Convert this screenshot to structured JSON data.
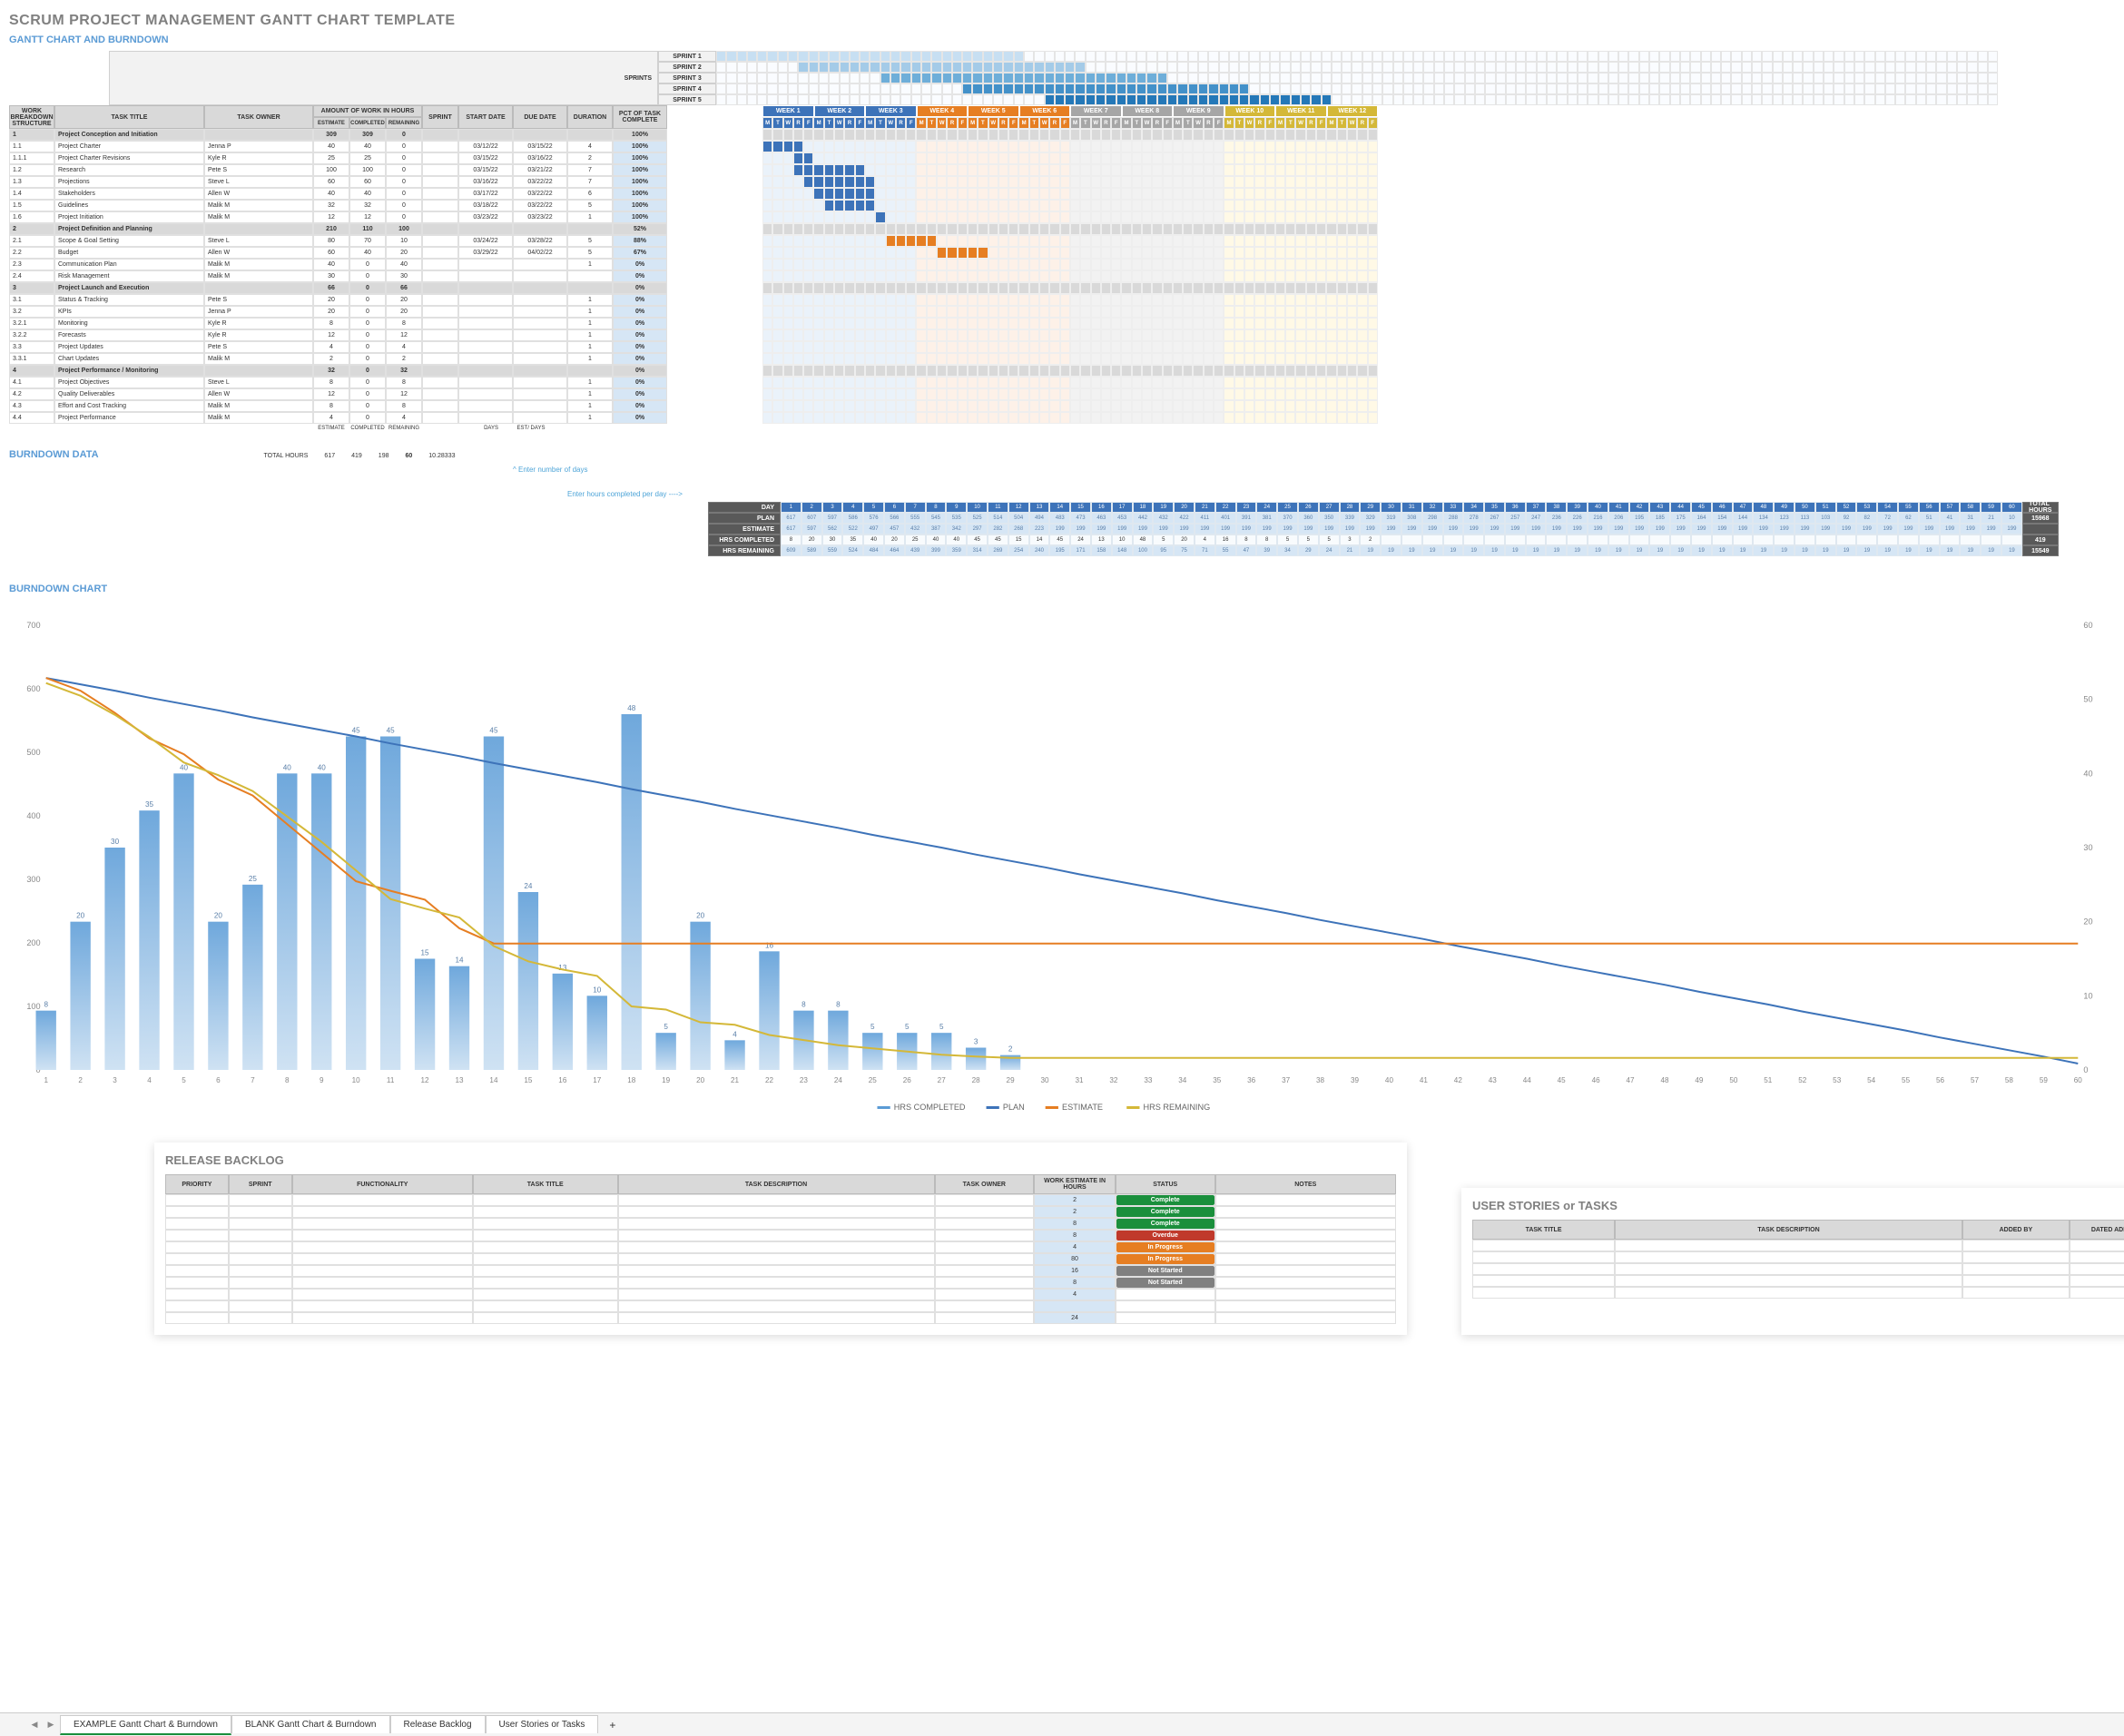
{
  "title": "SCRUM PROJECT MANAGEMENT GANTT CHART TEMPLATE",
  "section_gantt": "GANTT CHART AND BURNDOWN",
  "sprints_label": "SPRINTS",
  "sprint_names": [
    "SPRINT 1",
    "SPRINT 2",
    "SPRINT 3",
    "SPRINT 4",
    "SPRINT 5"
  ],
  "gantt_cols": {
    "wbs": "WORK BREAKDOWN STRUCTURE",
    "title": "TASK TITLE",
    "owner": "TASK OWNER",
    "amount": "AMOUNT OF WORK IN HOURS",
    "est": "ESTIMATE",
    "comp": "COMPLETED",
    "rem": "REMAINING",
    "sprint": "SPRINT",
    "start": "START DATE",
    "due": "DUE DATE",
    "dur": "DURATION",
    "pct": "PCT OF TASK COMPLETE"
  },
  "day_letters": [
    "M",
    "T",
    "W",
    "R",
    "F"
  ],
  "weeks": [
    {
      "label": "WEEK 1",
      "color": "#3d73b9",
      "tint": "tint-b"
    },
    {
      "label": "WEEK 2",
      "color": "#3d73b9",
      "tint": "tint-b"
    },
    {
      "label": "WEEK 3",
      "color": "#3d73b9",
      "tint": "tint-b"
    },
    {
      "label": "WEEK 4",
      "color": "#e67e22",
      "tint": "tint-o"
    },
    {
      "label": "WEEK 5",
      "color": "#e67e22",
      "tint": "tint-o"
    },
    {
      "label": "WEEK 6",
      "color": "#e67e22",
      "tint": "tint-o"
    },
    {
      "label": "WEEK 7",
      "color": "#a6a6a6",
      "tint": "tint-g"
    },
    {
      "label": "WEEK 8",
      "color": "#a6a6a6",
      "tint": "tint-g"
    },
    {
      "label": "WEEK 9",
      "color": "#a6a6a6",
      "tint": "tint-g"
    },
    {
      "label": "WEEK 10",
      "color": "#d4b838",
      "tint": "tint-y"
    },
    {
      "label": "WEEK 11",
      "color": "#d4b838",
      "tint": "tint-y"
    },
    {
      "label": "WEEK 12",
      "color": "#d4b838",
      "tint": "tint-y"
    }
  ],
  "tasks": [
    {
      "wbs": "1",
      "title": "Project Conception and Initiation",
      "owner": "",
      "est": 309,
      "comp": 309,
      "rem": 0,
      "start": "",
      "due": "",
      "dur": "",
      "pct": "100%",
      "grp": true
    },
    {
      "wbs": "1.1",
      "title": "Project Charter",
      "owner": "Jenna P",
      "est": 40,
      "comp": 40,
      "rem": 0,
      "start": "03/12/22",
      "due": "03/15/22",
      "dur": 4,
      "pct": "100%",
      "bar": [
        0,
        4
      ],
      "col": "fill-b"
    },
    {
      "wbs": "1.1.1",
      "title": "Project Charter Revisions",
      "owner": "Kyle R",
      "est": 25,
      "comp": 25,
      "rem": 0,
      "start": "03/15/22",
      "due": "03/16/22",
      "dur": 2,
      "pct": "100%",
      "bar": [
        3,
        5
      ],
      "col": "fill-b"
    },
    {
      "wbs": "1.2",
      "title": "Research",
      "owner": "Pete S",
      "est": 100,
      "comp": 100,
      "rem": 0,
      "start": "03/15/22",
      "due": "03/21/22",
      "dur": 7,
      "pct": "100%",
      "bar": [
        3,
        10
      ],
      "col": "fill-b"
    },
    {
      "wbs": "1.3",
      "title": "Projections",
      "owner": "Steve L",
      "est": 60,
      "comp": 60,
      "rem": 0,
      "start": "03/16/22",
      "due": "03/22/22",
      "dur": 7,
      "pct": "100%",
      "bar": [
        4,
        11
      ],
      "col": "fill-b"
    },
    {
      "wbs": "1.4",
      "title": "Stakeholders",
      "owner": "Allen W",
      "est": 40,
      "comp": 40,
      "rem": 0,
      "start": "03/17/22",
      "due": "03/22/22",
      "dur": 6,
      "pct": "100%",
      "bar": [
        5,
        11
      ],
      "col": "fill-b"
    },
    {
      "wbs": "1.5",
      "title": "Guidelines",
      "owner": "Malik M",
      "est": 32,
      "comp": 32,
      "rem": 0,
      "start": "03/18/22",
      "due": "03/22/22",
      "dur": 5,
      "pct": "100%",
      "bar": [
        6,
        11
      ],
      "col": "fill-b"
    },
    {
      "wbs": "1.6",
      "title": "Project Initiation",
      "owner": "Malik M",
      "est": 12,
      "comp": 12,
      "rem": 0,
      "start": "03/23/22",
      "due": "03/23/22",
      "dur": 1,
      "pct": "100%",
      "bar": [
        11,
        12
      ],
      "col": "fill-b"
    },
    {
      "wbs": "2",
      "title": "Project Definition and Planning",
      "owner": "",
      "est": 210,
      "comp": 110,
      "rem": 100,
      "start": "",
      "due": "",
      "dur": "",
      "pct": "52%",
      "grp": true
    },
    {
      "wbs": "2.1",
      "title": "Scope & Goal Setting",
      "owner": "Steve L",
      "est": 80,
      "comp": 70,
      "rem": 10,
      "start": "03/24/22",
      "due": "03/28/22",
      "dur": 5,
      "pct": "88%",
      "bar": [
        12,
        17
      ],
      "col": "fill-o"
    },
    {
      "wbs": "2.2",
      "title": "Budget",
      "owner": "Allen W",
      "est": 60,
      "comp": 40,
      "rem": 20,
      "start": "03/29/22",
      "due": "04/02/22",
      "dur": 5,
      "pct": "67%",
      "bar": [
        17,
        22
      ],
      "col": "fill-o"
    },
    {
      "wbs": "2.3",
      "title": "Communication Plan",
      "owner": "Malik M",
      "est": 40,
      "comp": 0,
      "rem": 40,
      "start": "",
      "due": "",
      "dur": 1,
      "pct": "0%"
    },
    {
      "wbs": "2.4",
      "title": "Risk Management",
      "owner": "Malik M",
      "est": 30,
      "comp": 0,
      "rem": 30,
      "start": "",
      "due": "",
      "dur": "",
      "pct": "0%"
    },
    {
      "wbs": "3",
      "title": "Project Launch and Execution",
      "owner": "",
      "est": 66,
      "comp": 0,
      "rem": 66,
      "start": "",
      "due": "",
      "dur": "",
      "pct": "0%",
      "grp": true
    },
    {
      "wbs": "3.1",
      "title": "Status & Tracking",
      "owner": "Pete S",
      "est": 20,
      "comp": 0,
      "rem": 20,
      "start": "",
      "due": "",
      "dur": 1,
      "pct": "0%"
    },
    {
      "wbs": "3.2",
      "title": "KPIs",
      "owner": "Jenna P",
      "est": 20,
      "comp": 0,
      "rem": 20,
      "start": "",
      "due": "",
      "dur": 1,
      "pct": "0%"
    },
    {
      "wbs": "3.2.1",
      "title": "Monitoring",
      "owner": "Kyle R",
      "est": 8,
      "comp": 0,
      "rem": 8,
      "start": "",
      "due": "",
      "dur": 1,
      "pct": "0%"
    },
    {
      "wbs": "3.2.2",
      "title": "Forecasts",
      "owner": "Kyle R",
      "est": 12,
      "comp": 0,
      "rem": 12,
      "start": "",
      "due": "",
      "dur": 1,
      "pct": "0%"
    },
    {
      "wbs": "3.3",
      "title": "Project Updates",
      "owner": "Pete S",
      "est": 4,
      "comp": 0,
      "rem": 4,
      "start": "",
      "due": "",
      "dur": 1,
      "pct": "0%"
    },
    {
      "wbs": "3.3.1",
      "title": "Chart Updates",
      "owner": "Malik M",
      "est": 2,
      "comp": 0,
      "rem": 2,
      "start": "",
      "due": "",
      "dur": 1,
      "pct": "0%"
    },
    {
      "wbs": "4",
      "title": "Project Performance / Monitoring",
      "owner": "",
      "est": 32,
      "comp": 0,
      "rem": 32,
      "start": "",
      "due": "",
      "dur": "",
      "pct": "0%",
      "grp": true
    },
    {
      "wbs": "4.1",
      "title": "Project Objectives",
      "owner": "Steve L",
      "est": 8,
      "comp": 0,
      "rem": 8,
      "start": "",
      "due": "",
      "dur": 1,
      "pct": "0%"
    },
    {
      "wbs": "4.2",
      "title": "Quality Deliverables",
      "owner": "Allen W",
      "est": 12,
      "comp": 0,
      "rem": 12,
      "start": "",
      "due": "",
      "dur": 1,
      "pct": "0%"
    },
    {
      "wbs": "4.3",
      "title": "Effort and Cost Tracking",
      "owner": "Malik M",
      "est": 8,
      "comp": 0,
      "rem": 8,
      "start": "",
      "due": "",
      "dur": 1,
      "pct": "0%"
    },
    {
      "wbs": "4.4",
      "title": "Project Performance",
      "owner": "Malik M",
      "est": 4,
      "comp": 0,
      "rem": 4,
      "start": "",
      "due": "",
      "dur": 1,
      "pct": "0%"
    }
  ],
  "totals_labels": {
    "est": "ESTIMATE",
    "comp": "COMPLETED",
    "rem": "REMAINING",
    "days": "DAYS",
    "estday": "EST/ DAYS"
  },
  "totals": {
    "label": "TOTAL HOURS",
    "est": 617,
    "comp": 419,
    "rem": 198,
    "days": 60,
    "estday": "10.28333"
  },
  "burndown": {
    "section": "BURNDOWN DATA",
    "hint1": "^ Enter number of days",
    "hint2": "Enter hours completed per day ---->",
    "row_labels": [
      "DAY",
      "PLAN",
      "ESTIMATE",
      "HRS COMPLETED",
      "HRS REMAINING"
    ],
    "total_label": "TOTAL HOURS",
    "days": 60,
    "plan": [
      617,
      607,
      597,
      586,
      576,
      566,
      555,
      545,
      535,
      525,
      514,
      504,
      494,
      483,
      473,
      463,
      453,
      442,
      432,
      422,
      411,
      401,
      391,
      381,
      370,
      360,
      350,
      339,
      329,
      319,
      308,
      298,
      288,
      278,
      267,
      257,
      247,
      236,
      226,
      216,
      206,
      195,
      185,
      175,
      164,
      154,
      144,
      134,
      123,
      113,
      103,
      92,
      82,
      72,
      62,
      51,
      41,
      31,
      21,
      10
    ],
    "estimate": [
      617,
      597,
      562,
      522,
      497,
      457,
      432,
      387,
      342,
      297,
      282,
      268,
      223,
      199,
      199,
      199,
      199,
      199,
      199,
      199,
      199,
      199,
      199,
      199,
      199,
      199,
      199,
      199,
      199,
      199,
      199,
      199,
      199,
      199,
      199,
      199,
      199,
      199,
      199,
      199,
      199,
      199,
      199,
      199,
      199,
      199,
      199,
      199,
      199,
      199,
      199,
      199,
      199,
      199,
      199,
      199,
      199,
      199,
      199,
      199
    ],
    "completed": [
      8,
      20,
      30,
      35,
      40,
      20,
      25,
      40,
      40,
      45,
      45,
      15,
      14,
      45,
      24,
      13,
      10,
      48,
      5,
      20,
      4,
      16,
      8,
      8,
      5,
      5,
      5,
      3,
      2,
      "",
      "",
      "",
      "",
      "",
      "",
      "",
      "",
      "",
      "",
      "",
      "",
      "",
      "",
      "",
      "",
      "",
      "",
      "",
      "",
      "",
      "",
      "",
      "",
      "",
      "",
      "",
      "",
      "",
      "",
      ""
    ],
    "remaining": [
      609,
      589,
      559,
      524,
      484,
      464,
      439,
      399,
      359,
      314,
      269,
      254,
      240,
      195,
      171,
      158,
      148,
      100,
      95,
      75,
      71,
      55,
      47,
      39,
      34,
      29,
      24,
      21,
      19,
      19,
      19,
      19,
      19,
      19,
      19,
      19,
      19,
      19,
      19,
      19,
      19,
      19,
      19,
      19,
      19,
      19,
      19,
      19,
      19,
      19,
      19,
      19,
      19,
      19,
      19,
      19,
      19,
      19,
      19,
      19
    ],
    "totals": {
      "plan": 15968,
      "completed": 419,
      "remaining": 15549
    }
  },
  "chart_title": "BURNDOWN CHART",
  "chart_data": {
    "type": "combo",
    "x": [
      1,
      2,
      3,
      4,
      5,
      6,
      7,
      8,
      9,
      10,
      11,
      12,
      13,
      14,
      15,
      16,
      17,
      18,
      19,
      20,
      21,
      22,
      23,
      24,
      25,
      26,
      27,
      28,
      29,
      30,
      31,
      32,
      33,
      34,
      35,
      36,
      37,
      38,
      39,
      40,
      41,
      42,
      43,
      44,
      45,
      46,
      47,
      48,
      49,
      50,
      51,
      52,
      53,
      54,
      55,
      56,
      57,
      58,
      59,
      60
    ],
    "y_left": {
      "min": 0,
      "max": 700,
      "label": ""
    },
    "y_right": {
      "min": 0,
      "max": 60,
      "label": ""
    },
    "series": [
      {
        "name": "HRS COMPLETED",
        "type": "bar",
        "axis": "right",
        "color": "#5b9bd5",
        "values": [
          8,
          20,
          30,
          35,
          40,
          20,
          25,
          40,
          40,
          45,
          45,
          15,
          14,
          45,
          24,
          13,
          10,
          48,
          5,
          20,
          4,
          16,
          8,
          8,
          5,
          5,
          5,
          3,
          2,
          0,
          0,
          0,
          0,
          0,
          0,
          0,
          0,
          0,
          0,
          0,
          0,
          0,
          0,
          0,
          0,
          0,
          0,
          0,
          0,
          0,
          0,
          0,
          0,
          0,
          0,
          0,
          0,
          0,
          0,
          0
        ]
      },
      {
        "name": "PLAN",
        "type": "line",
        "axis": "left",
        "color": "#3d73b9",
        "values": [
          617,
          607,
          597,
          586,
          576,
          566,
          555,
          545,
          535,
          525,
          514,
          504,
          494,
          483,
          473,
          463,
          453,
          442,
          432,
          422,
          411,
          401,
          391,
          381,
          370,
          360,
          350,
          339,
          329,
          319,
          308,
          298,
          288,
          278,
          267,
          257,
          247,
          236,
          226,
          216,
          206,
          195,
          185,
          175,
          164,
          154,
          144,
          134,
          123,
          113,
          103,
          92,
          82,
          72,
          62,
          51,
          41,
          31,
          21,
          10
        ]
      },
      {
        "name": "ESTIMATE",
        "type": "line",
        "axis": "left",
        "color": "#e67e22",
        "values": [
          617,
          597,
          562,
          522,
          497,
          457,
          432,
          387,
          342,
          297,
          282,
          268,
          223,
          199,
          199,
          199,
          199,
          199,
          199,
          199,
          199,
          199,
          199,
          199,
          199,
          199,
          199,
          199,
          199,
          199,
          199,
          199,
          199,
          199,
          199,
          199,
          199,
          199,
          199,
          199,
          199,
          199,
          199,
          199,
          199,
          199,
          199,
          199,
          199,
          199,
          199,
          199,
          199,
          199,
          199,
          199,
          199,
          199,
          199,
          199
        ]
      },
      {
        "name": "HRS REMAINING",
        "type": "line",
        "axis": "left",
        "color": "#d4b838",
        "values": [
          609,
          589,
          559,
          524,
          484,
          464,
          439,
          399,
          359,
          314,
          269,
          254,
          240,
          195,
          171,
          158,
          148,
          100,
          95,
          75,
          71,
          55,
          47,
          39,
          34,
          29,
          24,
          21,
          19,
          19,
          19,
          19,
          19,
          19,
          19,
          19,
          19,
          19,
          19,
          19,
          19,
          19,
          19,
          19,
          19,
          19,
          19,
          19,
          19,
          19,
          19,
          19,
          19,
          19,
          19,
          19,
          19,
          19,
          19,
          19
        ]
      }
    ],
    "legend": [
      "HRS COMPLETED",
      "PLAN",
      "ESTIMATE",
      "HRS REMAINING"
    ]
  },
  "backlog": {
    "title": "RELEASE BACKLOG",
    "cols": [
      "PRIORITY",
      "SPRINT",
      "FUNCTIONALITY",
      "TASK TITLE",
      "TASK DESCRIPTION",
      "TASK OWNER",
      "WORK ESTIMATE IN HOURS",
      "STATUS",
      "NOTES"
    ],
    "rows": [
      {
        "est": 2,
        "status": "Complete",
        "color": "#1a8f3c"
      },
      {
        "est": 2,
        "status": "Complete",
        "color": "#1a8f3c"
      },
      {
        "est": 8,
        "status": "Complete",
        "color": "#1a8f3c"
      },
      {
        "est": 8,
        "status": "Overdue",
        "color": "#c0392b"
      },
      {
        "est": 4,
        "status": "In Progress",
        "color": "#e67e22"
      },
      {
        "est": 80,
        "status": "In Progress",
        "color": "#e67e22"
      },
      {
        "est": 16,
        "status": "Not Started",
        "color": "#808080"
      },
      {
        "est": 8,
        "status": "Not Started",
        "color": "#808080"
      },
      {
        "est": 4,
        "status": "",
        "color": ""
      },
      {
        "est": "",
        "status": "",
        "color": ""
      },
      {
        "est": 24,
        "status": "",
        "color": ""
      }
    ]
  },
  "stories": {
    "title": "USER STORIES or TASKS",
    "cols": [
      "TASK TITLE",
      "TASK DESCRIPTION",
      "ADDED BY",
      "DATED ADDED"
    ]
  },
  "tabs": [
    "EXAMPLE Gantt Chart & Burndown",
    "BLANK Gantt Chart & Burndown",
    "Release Backlog",
    "User Stories or Tasks"
  ]
}
